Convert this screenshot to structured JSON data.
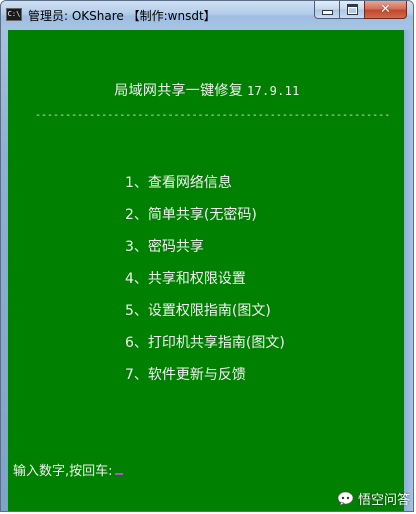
{
  "window": {
    "title": "管理员:  OKShare 【制作:wnsdt】",
    "icon": "console-icon",
    "controls": {
      "minimize": "minimize-icon",
      "maximize": "maximize-icon",
      "close": "close-icon"
    }
  },
  "console": {
    "background_color": "#008000",
    "text_color": "#f2f2f2",
    "heading": "局域网共享一键修复",
    "version": "17.9.11",
    "divider": "-------------------------------------------------------------",
    "menu": [
      "1、查看网络信息",
      "2、简单共享(无密码)",
      "3、密码共享",
      "4、共享和权限设置",
      "5、设置权限指南(图文)",
      "6、打印机共享指南(图文)",
      "7、软件更新与反馈"
    ],
    "prompt": "输入数字,按回车:",
    "cursor_color": "#b34fd1"
  },
  "watermark": {
    "text": "悟空问答",
    "icon": "chat-bubble-logo-icon"
  }
}
